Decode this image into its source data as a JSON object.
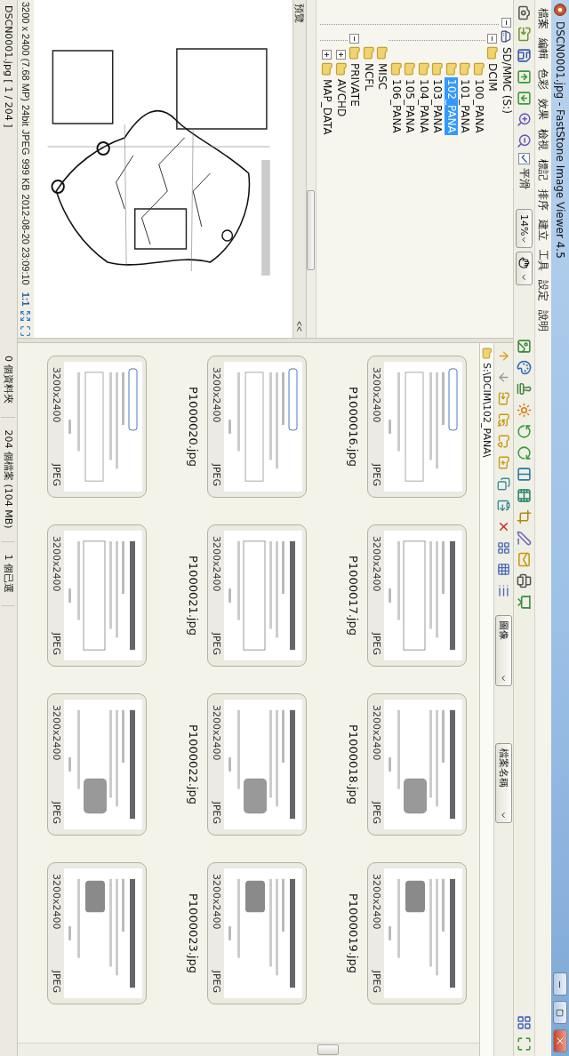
{
  "window": {
    "title": "DSCN0001.jpg - FastStone Image Viewer 4.5"
  },
  "menu": [
    "檔案",
    "編輯",
    "色彩",
    "效果",
    "檢視",
    "標記",
    "排序",
    "建立",
    "工具",
    "設定",
    "說明"
  ],
  "toolbar": {
    "smooth": {
      "label": "平滑",
      "checked": true
    },
    "zoom": "14%"
  },
  "folder_tree": [
    {
      "label": "SD/MMC (S:)",
      "expanded": true,
      "selected": false,
      "children": [
        {
          "label": "DCIM",
          "expanded": true,
          "selected": false,
          "children": [
            {
              "label": "100_PANA",
              "selected": false
            },
            {
              "label": "101_PANA",
              "selected": false
            },
            {
              "label": "102_PANA",
              "selected": true
            },
            {
              "label": "103_PANA",
              "selected": false
            },
            {
              "label": "104_PANA",
              "selected": false
            },
            {
              "label": "105_PANA",
              "selected": false
            },
            {
              "label": "106_PANA",
              "selected": false
            }
          ]
        },
        {
          "label": "MISC",
          "selected": false
        },
        {
          "label": "NCFL",
          "selected": false
        },
        {
          "label": "PRIVATE",
          "expanded": true,
          "selected": false,
          "children": [
            {
              "label": "AVCHD",
              "expanded": false,
              "selected": false
            },
            {
              "label": "MAP_DATA",
              "expanded": false,
              "selected": false
            }
          ]
        }
      ]
    }
  ],
  "preview": {
    "title": "預覽",
    "collapse": "<<",
    "info": [
      "3200 x 2400 (7.68 MP)",
      "24bit",
      "JPEG",
      "999 KB",
      "2012-08-20 23:09:10"
    ],
    "ratio": "1:1"
  },
  "browser": {
    "sort": [
      "圖像",
      "檔案名稱"
    ],
    "path": "S:\\DCIM\\102_PANA\\",
    "thumbnails": [
      {
        "name": "P1000016.jpg",
        "size": "3200x2400",
        "format": "JPEG"
      },
      {
        "name": "P1000017.jpg",
        "size": "3200x2400",
        "format": "JPEG"
      },
      {
        "name": "P1000018.jpg",
        "size": "3200x2400",
        "format": "JPEG"
      },
      {
        "name": "P1000019.jpg",
        "size": "3200x2400",
        "format": "JPEG"
      },
      {
        "name": "P1000020.jpg",
        "size": "3200x2400",
        "format": "JPEG"
      },
      {
        "name": "P1000021.jpg",
        "size": "3200x2400",
        "format": "JPEG"
      },
      {
        "name": "P1000022.jpg",
        "size": "3200x2400",
        "format": "JPEG"
      },
      {
        "name": "P1000023.jpg",
        "size": "3200x2400",
        "format": "JPEG"
      },
      {
        "size": "3200x2400",
        "format": "JPEG"
      },
      {
        "size": "3200x2400",
        "format": "JPEG"
      },
      {
        "size": "3200x2400",
        "format": "JPEG"
      },
      {
        "size": "3200x2400",
        "format": "JPEG"
      }
    ]
  },
  "status_bar": {
    "file": "DSCN0001.jpg [ 1 / 204 ]",
    "cells": [
      "0 個資料夾",
      "204 個檔案 (104 MB)",
      "1 個已選"
    ]
  }
}
